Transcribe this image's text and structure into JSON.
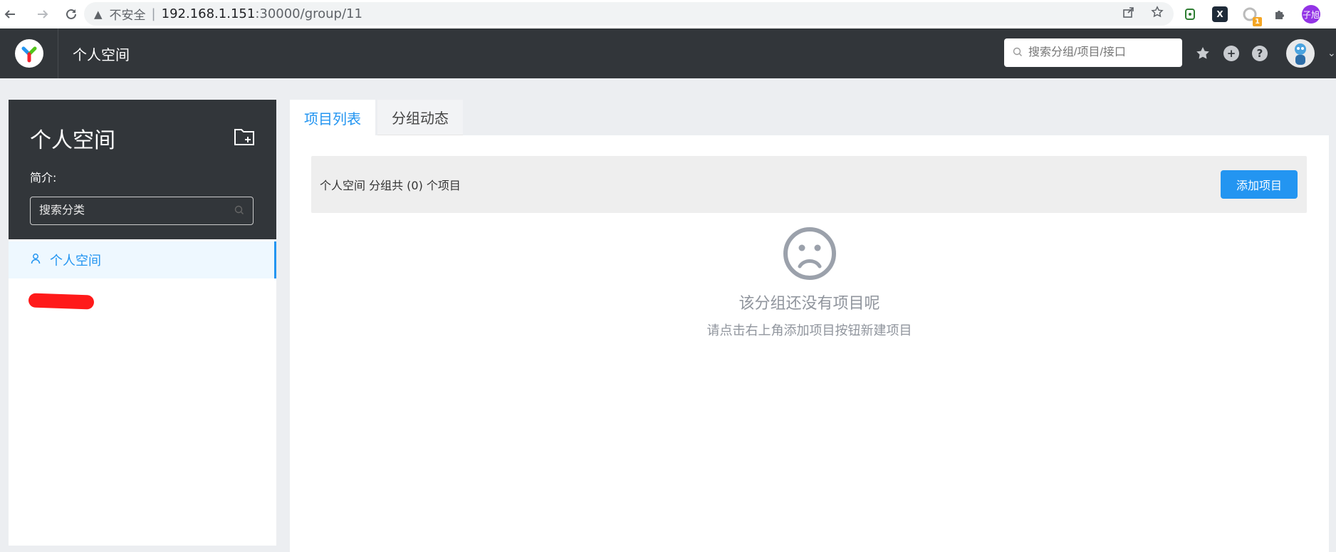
{
  "browser": {
    "security_label": "不安全",
    "url_host": "192.168.1.151",
    "url_path": ":30000/group/11",
    "profile_label": "子旭",
    "extension_badge": "1"
  },
  "header": {
    "title": "个人空间",
    "search_placeholder": "搜索分组/项目/接口"
  },
  "sidebar": {
    "group_title": "个人空间",
    "intro_label": "简介:",
    "search_placeholder": "搜索分类",
    "items": [
      {
        "label": "个人空间",
        "active": true
      }
    ]
  },
  "tabs": [
    {
      "label": "项目列表",
      "active": true
    },
    {
      "label": "分组动态",
      "active": false
    }
  ],
  "main": {
    "summary": "个人空间 分组共 (0) 个项目",
    "add_button": "添加项目",
    "empty_title": "该分组还没有项目呢",
    "empty_desc": "请点击右上角添加项目按钮新建项目"
  },
  "colors": {
    "accent": "#2395f1",
    "header_bg": "#32363a",
    "page_bg": "#eceef1",
    "empty_text": "#90959d"
  },
  "icons": [
    "back-arrow-icon",
    "forward-arrow-icon",
    "reload-icon",
    "warning-icon",
    "share-icon",
    "bookmark-star-icon",
    "extension-icon",
    "puzzle-icon",
    "search-icon",
    "star-icon",
    "plus-circle-icon",
    "help-icon",
    "avatar",
    "folder-add-icon",
    "user-icon",
    "sad-face-icon"
  ]
}
